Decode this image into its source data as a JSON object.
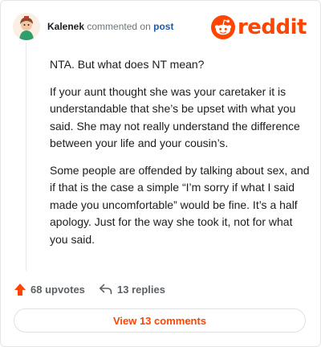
{
  "comment": {
    "author": "Kalenek",
    "action_text": "commented on",
    "target_link": "post",
    "paragraphs": [
      "NTA. But what does NT mean?",
      "If your aunt thought she was your caretaker it is understandable that she’s be upset with what you said. She may not really understand the difference between your life and your cousin’s.",
      "Some people are offended by talking about sex, and if that is the case a simple “I’m sorry if what I said made you uncomfortable” would be fine. It’s a half apology. Just for the way she took it, not for what you said."
    ]
  },
  "brand": {
    "wordmark": "reddit",
    "color": "#ff4500",
    "icon": "reddit-snoo-icon"
  },
  "actions": {
    "upvotes_label": "68 upvotes",
    "replies_label": "13 replies",
    "upvote_icon": "upvote-arrow-icon",
    "reply_icon": "reply-arrow-icon",
    "upvote_color": "#ff4500"
  },
  "view_comments_label": "View 13 comments"
}
